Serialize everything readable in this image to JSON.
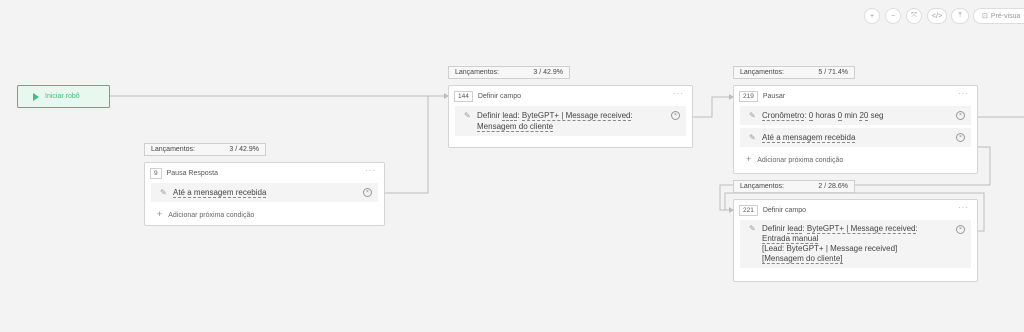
{
  "toolbar": {
    "zoom_in": "+",
    "zoom_out": "−",
    "fit": "⤧",
    "code": "</>",
    "export": "⤒",
    "preview_label": "Pré-visua"
  },
  "start": {
    "label": "Iniciar robô"
  },
  "nodes": [
    {
      "stat_label": "Lançamentos:",
      "stat_value": "3 / 42.9%",
      "id": "9",
      "title": "Pausa Resposta",
      "row1": "Até a mensagem recebida",
      "add": "Adicionar próxima condição"
    },
    {
      "stat_label": "Lançamentos:",
      "stat_value": "3 / 42.9%",
      "id": "144",
      "title": "Definir campo",
      "row_a": "Definir ",
      "row_b": "lead",
      "row_c": ": ",
      "row_d": "ByteGPT+ | Message received",
      "row_e": ":",
      "row_f": "Mensagem do cliente"
    },
    {
      "stat_label": "Lançamentos:",
      "stat_value": "5 / 71.4%",
      "id": "219",
      "title": "Pausar",
      "crono": "Cronômetro",
      "colon": ":",
      "h": "0",
      "hl": "horas",
      "m": "0",
      "ml": "min",
      "s": "20",
      "sl": "seg",
      "row2": "Até a mensagem recebida",
      "add": "Adicionar próxima condição"
    },
    {
      "stat_label": "Lançamentos:",
      "stat_value": "2 / 28.6%",
      "id": "221",
      "title": "Definir campo",
      "row_a": "Definir ",
      "row_b": "lead",
      "row_c": ": ",
      "row_d": "ByteGPT+ | Message received",
      "row_e": ":",
      "row_f": "Entrada manual",
      "row_g": "[Lead: ByteGPT+ | Message received]",
      "row_h": "[Mensagem do cliente]"
    }
  ]
}
